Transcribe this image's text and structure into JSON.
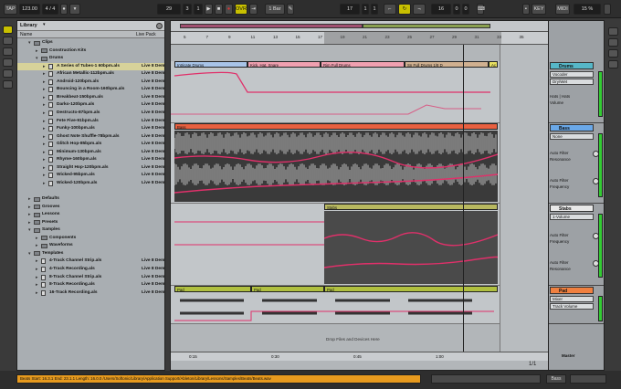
{
  "transport": {
    "tap": "TAP",
    "tempo": "123.00",
    "signature": "4 / 4",
    "bar_pos": "29",
    "beat_pos": "3",
    "sub_pos": "1",
    "ovr": "OVR",
    "quantize": "1 Bar",
    "loop_start": "17",
    "loop_beat": "1",
    "loop_sub": "1",
    "loop_len": "16",
    "loop_len_beat": "0",
    "loop_len_sub": "0",
    "key": "KEY",
    "midi": "MIDI",
    "cpu": "15 %"
  },
  "browser": {
    "title": "Library",
    "col_name": "Name",
    "col_type": "Live Pack",
    "rows": [
      {
        "name": "Library",
        "type": "Live Pack",
        "level": 0,
        "kind": "folder",
        "open": true
      },
      {
        "name": "Clips",
        "type": "",
        "level": 1,
        "kind": "folder",
        "open": true
      },
      {
        "name": "Construction Kits",
        "type": "",
        "level": 2,
        "kind": "folder",
        "open": false
      },
      {
        "name": "Drums",
        "type": "",
        "level": 2,
        "kind": "folder",
        "open": true
      },
      {
        "name": "A Series of Tubes-1 60bpm.als",
        "type": "Live 8 Dem",
        "level": 3,
        "kind": "file",
        "sel": true
      },
      {
        "name": "African Metallic-112bpm.als",
        "type": "Live 8 Dem",
        "level": 3,
        "kind": "file"
      },
      {
        "name": "Android-120bpm.als",
        "type": "Live 8 Dem",
        "level": 3,
        "kind": "file"
      },
      {
        "name": "Bouncing in a Room-160bpm.als",
        "type": "Live 8 Dem",
        "level": 3,
        "kind": "file"
      },
      {
        "name": "Breakbeat-150bpm.als",
        "type": "Live 8 Dem",
        "level": 3,
        "kind": "file"
      },
      {
        "name": "Darko-120bpm.als",
        "type": "Live 8 Dem",
        "level": 3,
        "kind": "file"
      },
      {
        "name": "Destructo-87bpm.als",
        "type": "Live 8 Dem",
        "level": 3,
        "kind": "file"
      },
      {
        "name": "Fete Five-91bpm.als",
        "type": "Live 8 Dem",
        "level": 3,
        "kind": "file"
      },
      {
        "name": "Funky-100bpm.als",
        "type": "Live 8 Dem",
        "level": 3,
        "kind": "file"
      },
      {
        "name": "Ghost Note Shuffle-78bpm.als",
        "type": "Live 8 Dem",
        "level": 3,
        "kind": "file"
      },
      {
        "name": "Glitch Hop-85bpm.als",
        "type": "Live 8 Dem",
        "level": 3,
        "kind": "file"
      },
      {
        "name": "Minimum-130bpm.als",
        "type": "Live 8 Dem",
        "level": 3,
        "kind": "file"
      },
      {
        "name": "Rhyme-160bpm.als",
        "type": "Live 8 Dem",
        "level": 3,
        "kind": "file"
      },
      {
        "name": "Straight Hop-120bpm.als",
        "type": "Live 8 Dem",
        "level": 3,
        "kind": "file"
      },
      {
        "name": "Wicked-95bpm.als",
        "type": "Live 8 Dem",
        "level": 3,
        "kind": "file"
      },
      {
        "name": "Wicked-120bpm.als",
        "type": "Live 8 Dem",
        "level": 3,
        "kind": "file"
      },
      {
        "name": "",
        "type": "",
        "level": 0,
        "kind": "blank"
      },
      {
        "name": "Defaults",
        "type": "",
        "level": 1,
        "kind": "folder",
        "open": false
      },
      {
        "name": "Grooves",
        "type": "",
        "level": 1,
        "kind": "folder",
        "open": false
      },
      {
        "name": "Lessons",
        "type": "",
        "level": 1,
        "kind": "folder",
        "open": false
      },
      {
        "name": "Presets",
        "type": "",
        "level": 1,
        "kind": "folder",
        "open": false
      },
      {
        "name": "Samples",
        "type": "",
        "level": 1,
        "kind": "folder",
        "open": true
      },
      {
        "name": "Components",
        "type": "",
        "level": 2,
        "kind": "folder",
        "open": false
      },
      {
        "name": "Waveforms",
        "type": "",
        "level": 2,
        "kind": "folder",
        "open": false
      },
      {
        "name": "Templates",
        "type": "",
        "level": 1,
        "kind": "folder",
        "open": true
      },
      {
        "name": "4-Track Channel Strip.als",
        "type": "Live 8 Dem",
        "level": 2,
        "kind": "file"
      },
      {
        "name": "4-Track Recording.als",
        "type": "Live 8 Dem",
        "level": 2,
        "kind": "file"
      },
      {
        "name": "8-Track Channel Strip.als",
        "type": "Live 8 Dem",
        "level": 2,
        "kind": "file"
      },
      {
        "name": "8-Track Recording.als",
        "type": "Live 8 Dem",
        "level": 2,
        "kind": "file"
      },
      {
        "name": "16-Track Recording.als",
        "type": "Live 8 Dem",
        "level": 2,
        "kind": "file"
      }
    ]
  },
  "arrangement": {
    "ruler": [
      "5",
      "7",
      "9",
      "11",
      "13",
      "15",
      "17",
      "19",
      "21",
      "23",
      "25",
      "27",
      "29",
      "31",
      "33",
      "35"
    ],
    "time_ruler": [
      "0:15",
      "0:30",
      "0:45",
      "1:00"
    ],
    "drop_text": "Drop Files and Devices Here",
    "page": "1/1",
    "drum_clips": [
      "Intricate Drums",
      "Kick, Hat, Snare",
      "Rim Full Drums",
      "Sn Full Drums 1/8 D",
      "Ac"
    ],
    "bass_clip": "Bass",
    "stabs_clip": "Stabs",
    "pad_clip": "Pad"
  },
  "tracks": [
    {
      "name": "Drums",
      "color": "#56b7c8",
      "sel1": "Vocoder",
      "sel2": "Dry/Wet",
      "p1": "Hats | Hats",
      "p2": "Volume"
    },
    {
      "name": "Bass",
      "color": "#6aa8e8",
      "sel1": "None",
      "sel2": "",
      "p1": "Auto Filter",
      "p2": "Resonance",
      "p3": "Auto Filter",
      "p4": "Frequency"
    },
    {
      "name": "Stabs",
      "color": "#e8e8e8",
      "sel1": "1-Volume",
      "sel2": "",
      "p1": "Auto Filter",
      "p2": "Frequency",
      "p3": "Auto Filter",
      "p4": "Resonance"
    },
    {
      "name": "Pad",
      "color": "#f08040",
      "sel1": "Mixer",
      "sel2": "Track Volume",
      "p1": "",
      "p2": ""
    },
    {
      "name": "Master",
      "color": "",
      "sel1": "",
      "sel2": "",
      "p1": "",
      "p2": ""
    }
  ],
  "status": "Beats Start: 16.3.1 End: 23.1.1 Length: 16.0.0 /Users/Softonic/Library/Application Support/Ableton/Library/Lessons/Samples/Beats/Beats.wav",
  "bottom_right": "Bass"
}
